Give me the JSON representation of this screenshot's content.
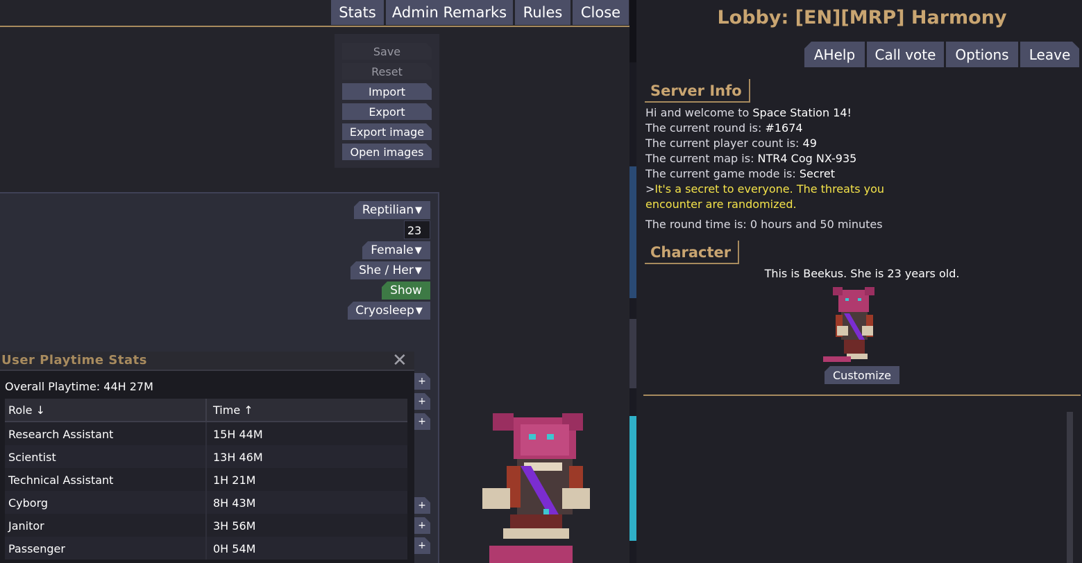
{
  "top_tabs": [
    "Stats",
    "Admin Remarks",
    "Rules",
    "Close"
  ],
  "actions": {
    "save": "Save",
    "reset": "Reset",
    "import": "Import",
    "export": "Export",
    "export_image": "Export image",
    "open_images": "Open images"
  },
  "profile": {
    "species": "Reptilian",
    "age": "23",
    "sex": "Female",
    "pronouns": "She / Her",
    "clothing_toggle": "Show",
    "spawn": "Cryosleep",
    "dropdown_glyph": "▼",
    "plus_glyph": "+"
  },
  "playtime": {
    "title": "User Playtime Stats",
    "close_glyph": "✕",
    "overall": "Overall Playtime: 44H 27M",
    "col_role": "Role ↓",
    "col_time": "Time ↑",
    "rows": [
      {
        "role": "Research Assistant",
        "time": "15H 44M"
      },
      {
        "role": "Scientist",
        "time": "13H 46M"
      },
      {
        "role": "Technical Assistant",
        "time": "1H 21M"
      },
      {
        "role": "Cyborg",
        "time": "8H 43M"
      },
      {
        "role": "Janitor",
        "time": "3H 56M"
      },
      {
        "role": "Passenger",
        "time": "0H 54M"
      }
    ]
  },
  "lobby": {
    "title": "Lobby: [EN][MRP] Harmony",
    "buttons": [
      "AHelp",
      "Call vote",
      "Options",
      "Leave"
    ],
    "server_info_heading": "Server Info",
    "welcome_prefix": "Hi and welcome to ",
    "welcome_name": "Space Station 14!",
    "round_prefix": "The current round is: ",
    "round_value": "#1674",
    "players_prefix": "The current player count is: ",
    "players_value": "49",
    "map_prefix": "The current map is: ",
    "map_value": "NTR4 Cog NX-935",
    "mode_prefix": "The current game mode is: ",
    "mode_value": "Secret",
    "mode_desc_marker": ">",
    "mode_desc_line1": "It's a secret to everyone. The threats you",
    "mode_desc_line2": "encounter are randomized.",
    "round_time": "The round time is: 0 hours and 50 minutes",
    "character_heading": "Character",
    "character_desc": "This is Beekus. She is 23 years old.",
    "customize": "Customize"
  },
  "colors": {
    "accent_gold": "#c9a571",
    "button": "#4b4e66",
    "show_green": "#3d7a45",
    "yellow_text": "#f4e34a"
  }
}
